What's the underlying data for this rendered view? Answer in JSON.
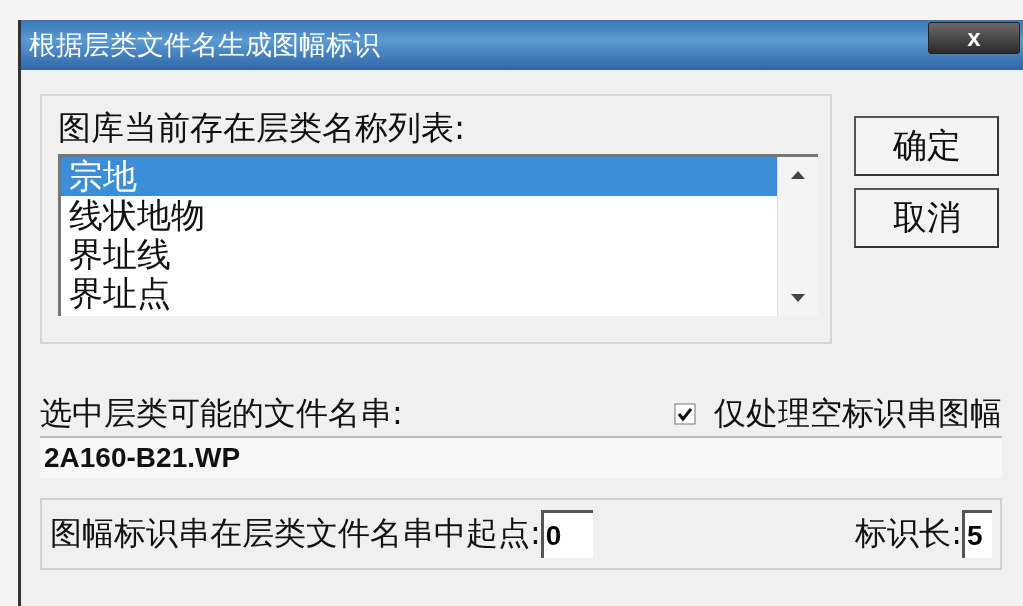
{
  "window": {
    "title": "根据层类文件名生成图幅标识",
    "close": "x"
  },
  "list_group": {
    "label": "图库当前存在层类名称列表:",
    "items": [
      {
        "label": "宗地",
        "selected": true
      },
      {
        "label": "线状地物",
        "selected": false
      },
      {
        "label": "界址线",
        "selected": false
      },
      {
        "label": "界址点",
        "selected": false
      }
    ]
  },
  "buttons": [
    "确定",
    "取消"
  ],
  "filename": {
    "label": "选中层类可能的文件名串:",
    "value": "2A160-B21.WP"
  },
  "only_empty": {
    "label": "仅处理空标识串图幅",
    "checked": true
  },
  "id_group": {
    "start_label": "图幅标识串在层类文件名串中起点:",
    "start_value": "0",
    "length_label": "标识长:",
    "length_value": "5"
  }
}
